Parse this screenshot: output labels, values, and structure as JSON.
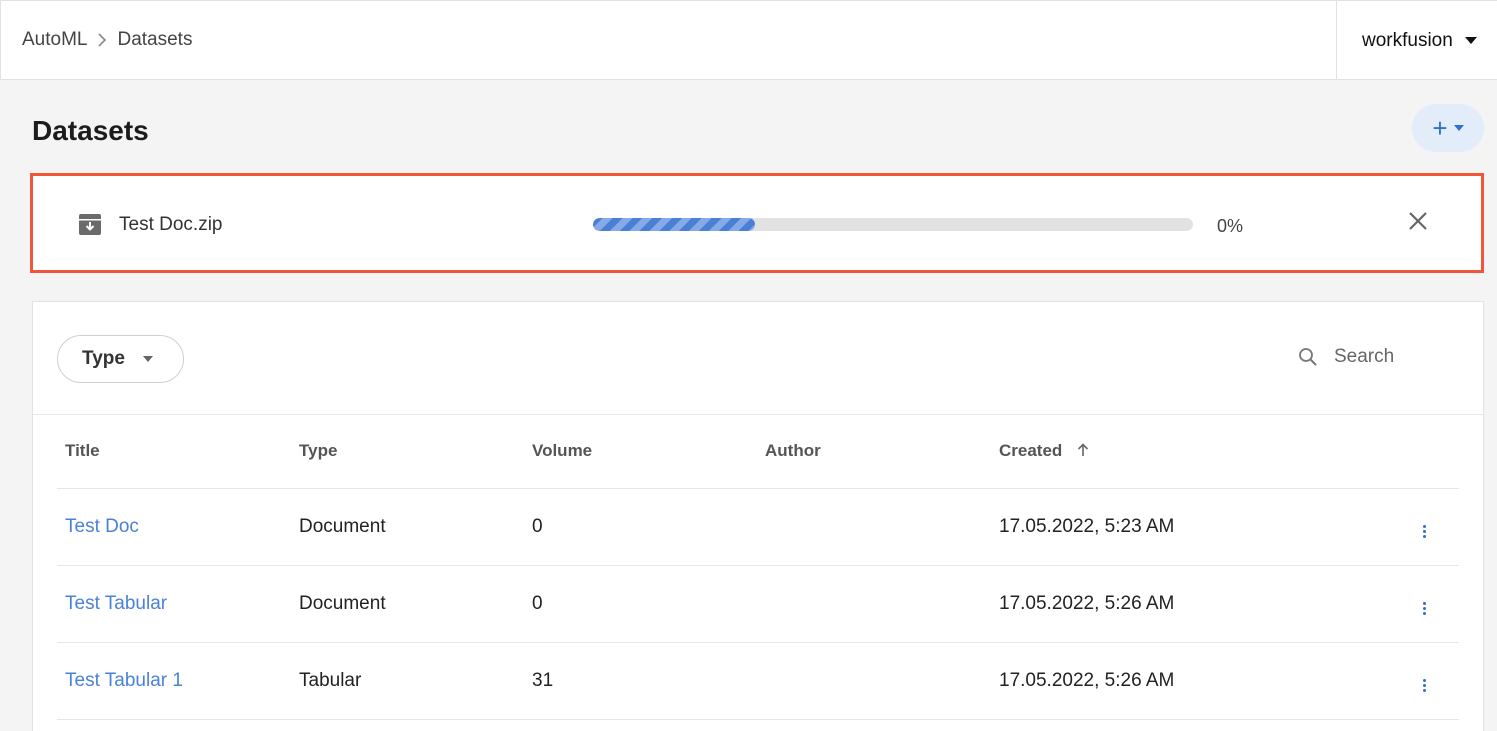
{
  "breadcrumb": {
    "root": "AutoML",
    "current": "Datasets"
  },
  "user": {
    "name": "workfusion"
  },
  "page": {
    "title": "Datasets",
    "add_button": "+"
  },
  "upload": {
    "file_name": "Test Doc.zip",
    "progress_fraction": 0.27,
    "percent_label": "0%"
  },
  "filters": {
    "type_label": "Type",
    "search_placeholder": "Search"
  },
  "table": {
    "headers": {
      "title": "Title",
      "type": "Type",
      "volume": "Volume",
      "author": "Author",
      "created": "Created"
    },
    "rows": [
      {
        "title": "Test Doc",
        "type": "Document",
        "volume": "0",
        "author": "",
        "created": "17.05.2022, 5:23 AM"
      },
      {
        "title": "Test Tabular",
        "type": "Document",
        "volume": "0",
        "author": "",
        "created": "17.05.2022, 5:26 AM"
      },
      {
        "title": "Test Tabular 1",
        "type": "Tabular",
        "volume": "31",
        "author": "",
        "created": "17.05.2022, 5:26 AM"
      }
    ]
  },
  "colors": {
    "accent": "#2f6fd1",
    "link": "#4a82d8",
    "highlight_border": "#f0573a"
  }
}
